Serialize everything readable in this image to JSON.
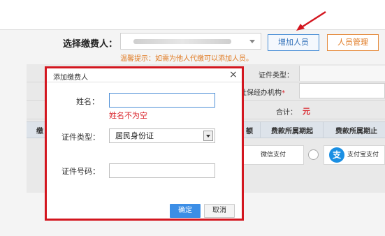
{
  "header": {
    "payer_label": "选择缴费人：",
    "add_person_label": "增加人员",
    "manage_person_label": "人员管理",
    "hint": "温馨提示：如需为他人代缴可以添加人员。"
  },
  "form": {
    "cert_type_label": "证件类型：",
    "agency_label": "社保经办机构",
    "agency_required_mark": "*",
    "total_label": "合计：",
    "total_value": "元"
  },
  "table": {
    "left_stub": "缴",
    "headers": [
      "额",
      "费款所属期起",
      "费款所属期止"
    ]
  },
  "payment": {
    "wechat_label": "微信支付",
    "alipay_icon": "支",
    "alipay_label": "支付宝支付"
  },
  "dialog": {
    "title": "添加缴费人",
    "close": "×",
    "name_label": "姓名：",
    "name_value": "",
    "name_error": "姓名不为空",
    "cert_type_label": "证件类型：",
    "cert_type_value": "居民身份证",
    "id_number_label": "证件号码：",
    "id_number_value": "",
    "confirm_label": "确定",
    "cancel_label": "取消"
  },
  "colors": {
    "highlight_border": "#d3161f",
    "accent_blue": "#3c8ee6",
    "accent_orange": "#e07a22",
    "error_red": "#d9232a"
  },
  "icons": [
    "red-arrow-icon",
    "chevron-down-icon",
    "close-icon",
    "alipay-icon"
  ]
}
